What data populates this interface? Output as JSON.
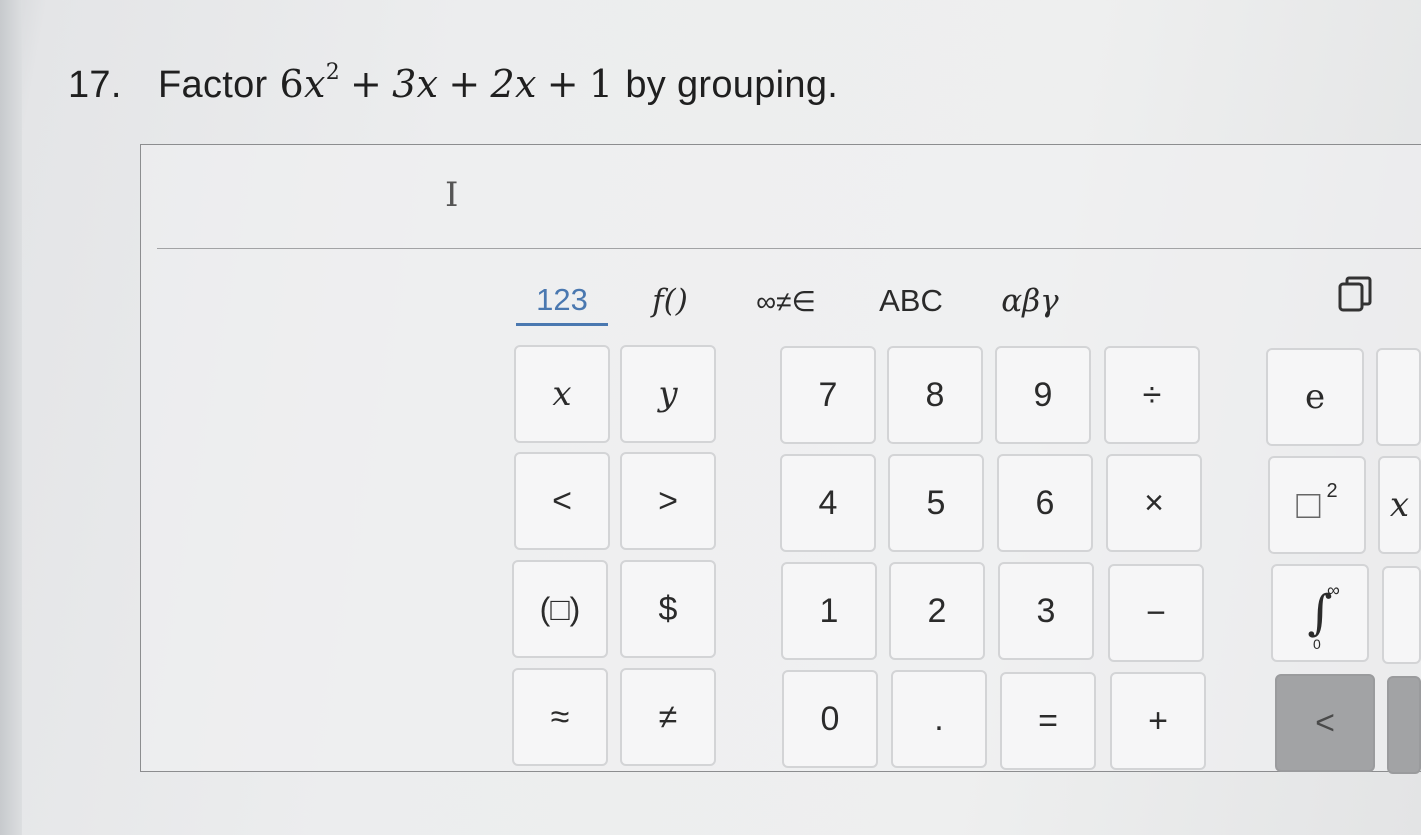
{
  "question": {
    "number": "17.",
    "prefix": "Factor",
    "expr": {
      "t1_coef": "6",
      "t1_var": "x",
      "t1_exp": "2",
      "op1": "+",
      "t2": "3x",
      "op2": "+",
      "t3": "2x",
      "op3": "+",
      "t4": "1"
    },
    "suffix": "by grouping."
  },
  "answer": {
    "value": "",
    "cursor_glyph": "I"
  },
  "tabs": [
    {
      "label": "123",
      "active": true
    },
    {
      "label": "f()",
      "active": false
    },
    {
      "label": "∞≠∈",
      "active": false
    },
    {
      "label": "ABC",
      "active": false
    },
    {
      "label": "αβγ",
      "active": false
    }
  ],
  "keys": {
    "x": "x",
    "y": "y",
    "lt": "<",
    "gt": ">",
    "paren": "(□)",
    "dollar": "$",
    "approx": "≈",
    "neq": "≠",
    "n7": "7",
    "n8": "8",
    "n9": "9",
    "div": "÷",
    "n4": "4",
    "n5": "5",
    "n6": "6",
    "mul": "×",
    "n1": "1",
    "n2": "2",
    "n3": "3",
    "minus": "−",
    "n0": "0",
    "dot": ".",
    "eq": "=",
    "plus": "+",
    "e": "e",
    "square_box": "□",
    "square_exp": "2",
    "integral": "∫",
    "int_upper": "∞",
    "int_lower": "0",
    "left": "<",
    "cut_row2": "x"
  },
  "colors": {
    "active_tab": "#4a78b0",
    "key_bg": "#f6f6f7",
    "key_border": "#d3d4d6",
    "dark_key": "#a2a3a5"
  }
}
